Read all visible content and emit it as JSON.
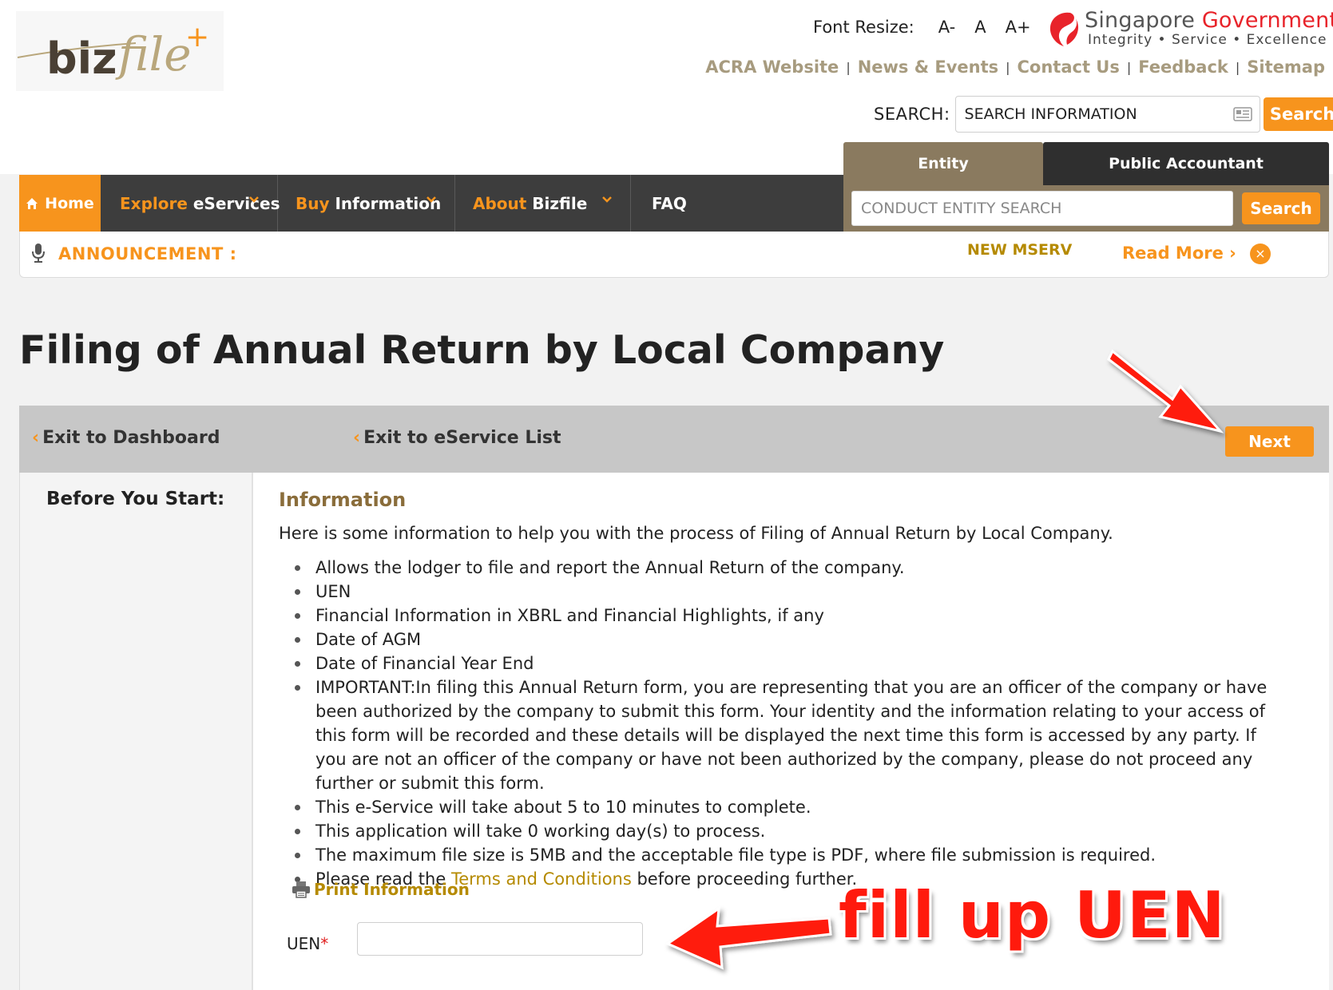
{
  "header": {
    "logo_text": "bizfile+",
    "font_resize": {
      "label": "Font Resize:",
      "options": [
        "A-",
        "A",
        "A+"
      ]
    },
    "sg_gov": {
      "word1": "Singapore",
      "word2": "Government",
      "tagline": "Integrity • Service • Excellence"
    },
    "links": [
      "ACRA Website",
      "News & Events",
      "Contact Us",
      "Feedback",
      "Sitemap"
    ],
    "link_separator": "|",
    "search": {
      "label": "SEARCH:",
      "placeholder": "SEARCH INFORMATION",
      "button": "Search"
    }
  },
  "nav": {
    "home": "Home",
    "explore": {
      "orange": "Explore",
      "rest": " eServices"
    },
    "buy": {
      "orange": "Buy",
      "rest": " Information"
    },
    "about": {
      "orange": "About",
      "rest": " Bizfile"
    },
    "faq": "FAQ"
  },
  "entity_search": {
    "tabs": [
      "Entity",
      "Public Accountant"
    ],
    "placeholder": "CONDUCT ENTITY SEARCH",
    "button": "Search"
  },
  "announcement": {
    "label": "ANNOUNCEMENT :",
    "text": "NEW MSERV",
    "read_more": "Read More ›",
    "close": "×"
  },
  "page": {
    "title": "Filing of Annual Return by Local Company"
  },
  "action_bar": {
    "exit_dashboard": "Exit to Dashboard",
    "exit_list": "Exit to eService List",
    "chevron": "‹",
    "next": "Next"
  },
  "sidebar": {
    "title": "Before You Start:"
  },
  "info": {
    "heading": "Information",
    "intro": "Here is some information to help you with the process of Filing of Annual Return by Local Company.",
    "items": [
      "Allows the lodger to file and report the Annual Return of the company.",
      "UEN",
      "Financial Information in XBRL and Financial Highlights, if any",
      "Date of AGM",
      "Date of Financial Year End",
      "IMPORTANT:In filing this Annual Return form, you are representing that you are an officer of the company or have been authorized by the company to submit this form. Your identity and the information relating to your access of this form will be recorded and these details will be displayed the next time this form is accessed by any party. If you are not an officer of the company or have not been authorized by the company, please do not proceed any further or submit this form.",
      "This e-Service will take about 5 to 10 minutes to complete.",
      "This application will take 0 working day(s) to process.",
      "The maximum file size is 5MB and the acceptable file type is PDF, where file submission is required."
    ],
    "terms": {
      "before": "Please read the ",
      "link": "Terms and Conditions",
      "after": " before proceeding further."
    },
    "print": "Print Information"
  },
  "form": {
    "uen_label": "UEN",
    "required_mark": "*",
    "uen_value": ""
  },
  "annotation": {
    "text": "fill up UEN"
  },
  "colors": {
    "accent": "#f7941d",
    "nav_bg": "#3d3d3d",
    "tab_brown": "#8a7a5f",
    "gold_link": "#b58a00",
    "annotation_red": "#ff1a0d"
  }
}
